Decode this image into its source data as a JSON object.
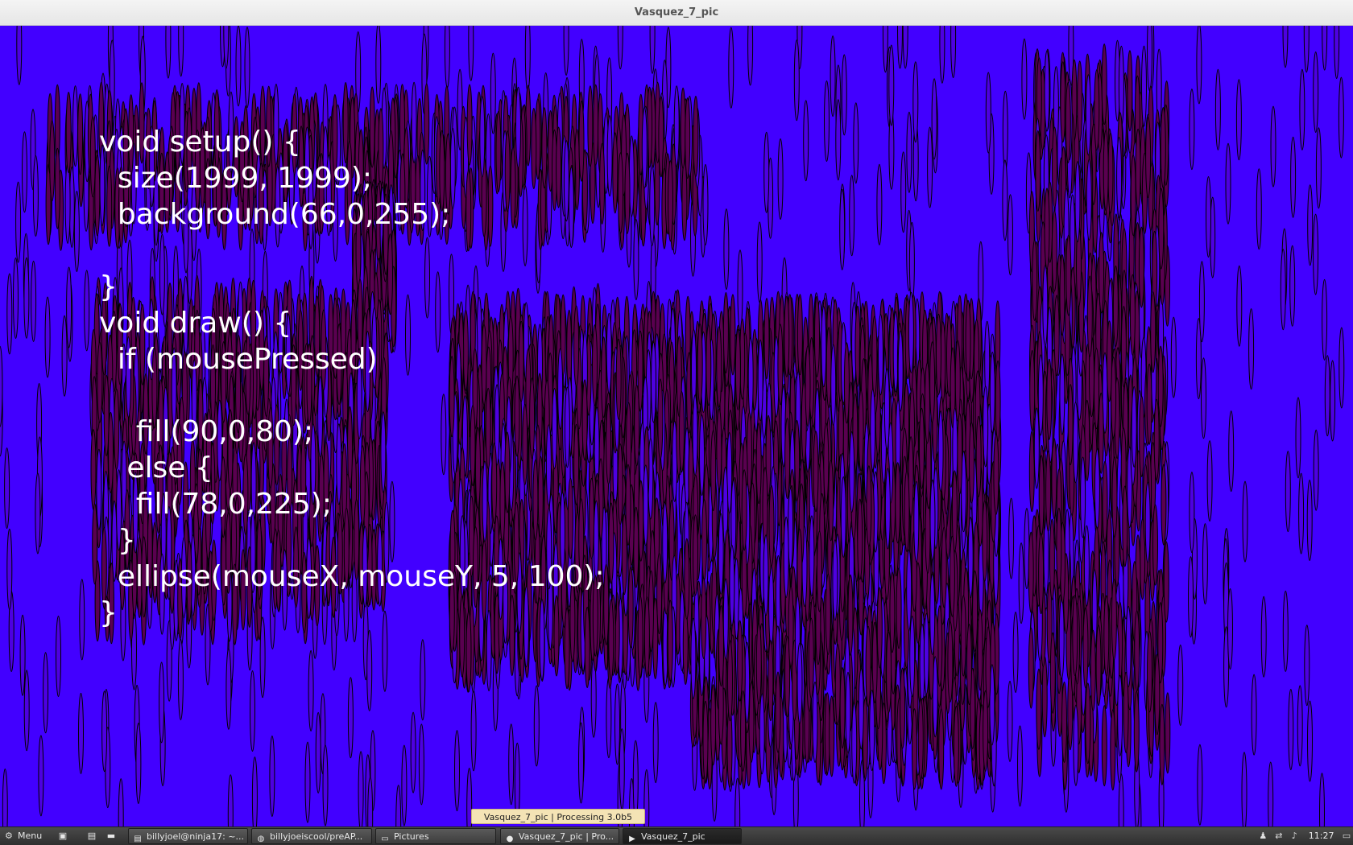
{
  "window": {
    "title": "Vasquez_7_pic"
  },
  "sketch": {
    "background_color": "#4200ff",
    "code": "void setup() {\n  size(1999, 1999);\n  background(66,0,255);\n\n}\nvoid draw() {\n  if (mousePressed)\n\n    fill(90,0,80);\n   else {\n    fill(78,0,225);\n  }\n  ellipse(mouseX, mouseY, 5, 100);\n}"
  },
  "tooltip": {
    "text": "Vasquez_7_pic | Processing 3.0b5"
  },
  "taskbar": {
    "menu_label": "Menu",
    "tasks": [
      {
        "label": "billyjoel@ninja17: ~...",
        "icon": "terminal-icon"
      },
      {
        "label": "billyjoeiscool/preAP...",
        "icon": "browser-icon"
      },
      {
        "label": "Pictures",
        "icon": "folder-icon"
      },
      {
        "label": "Vasquez_7_pic | Pro...",
        "icon": "processing-icon"
      },
      {
        "label": "Vasquez_7_pic",
        "icon": "sketch-run-icon"
      }
    ],
    "clock": "11:27"
  }
}
